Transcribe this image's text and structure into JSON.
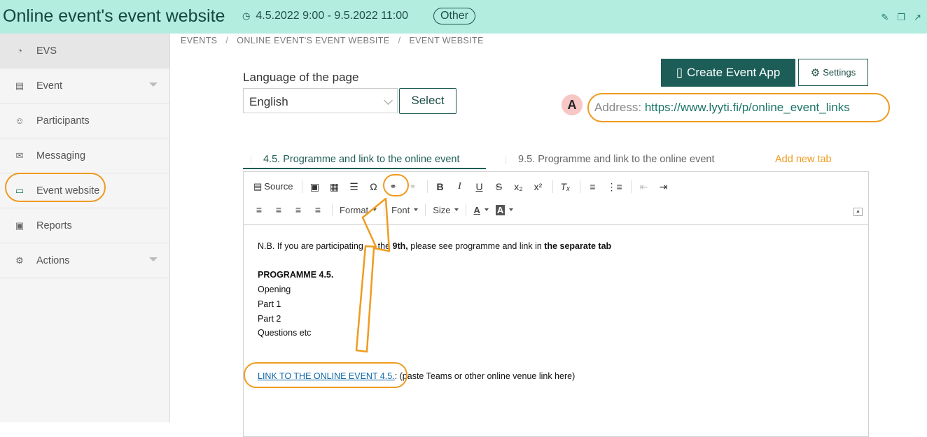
{
  "header": {
    "title": "Online event's event website",
    "date": "4.5.2022 9:00 - 9.5.2022 11:00",
    "badge": "Other",
    "icons": [
      "edit-icon",
      "copy-icon",
      "external-link-icon"
    ]
  },
  "sidebar": {
    "items": [
      {
        "label": "EVS",
        "icon": "dashboard-icon",
        "active": true
      },
      {
        "label": "Event",
        "icon": "calendar-icon",
        "caret": true
      },
      {
        "label": "Participants",
        "icon": "people-icon"
      },
      {
        "label": "Messaging",
        "icon": "mail-icon"
      },
      {
        "label": "Event website",
        "icon": "laptop-icon"
      },
      {
        "label": "Reports",
        "icon": "report-icon"
      },
      {
        "label": "Actions",
        "icon": "gear-icon",
        "caret": true
      }
    ]
  },
  "breadcrumb": [
    "EVENTS",
    "ONLINE EVENT'S EVENT WEBSITE",
    "EVENT WEBSITE"
  ],
  "language": {
    "label": "Language of the page",
    "selected": "English",
    "button": "Select"
  },
  "actions": {
    "create_app": "Create Event App",
    "settings": "Settings"
  },
  "address": {
    "annotation": "A",
    "label": "Address:",
    "url": "https://www.lyyti.fi/p/online_event_links"
  },
  "tabs": [
    {
      "label": "4.5. Programme and link to the online event",
      "active": true
    },
    {
      "label": "9.5. Programme and link to the online event",
      "active": false
    },
    {
      "label": "Add new tab"
    }
  ],
  "toolbar": {
    "source": "Source",
    "format": "Format",
    "font": "Font",
    "size": "Size"
  },
  "content": {
    "nb_prefix": "N.B. If you are participating",
    "nb_hidden": " on ",
    "nb_mid": "the ",
    "nb_bold1": "9th,",
    "nb_rest": " please see programme and link in ",
    "nb_bold2": "the separate tab",
    "programme_heading": "PROGRAMME 4.5.",
    "lines": [
      "Opening",
      "Part 1",
      "Part 2",
      "Questions etc"
    ],
    "link_text": "LINK TO THE ONLINE EVENT 4.5.",
    "link_suffix": ": (paste Teams or other online venue link here)"
  },
  "colors": {
    "header_bg": "#b3ede0",
    "primary": "#1c5e57",
    "annotation": "#ef9b20",
    "link": "#0b65a8"
  }
}
